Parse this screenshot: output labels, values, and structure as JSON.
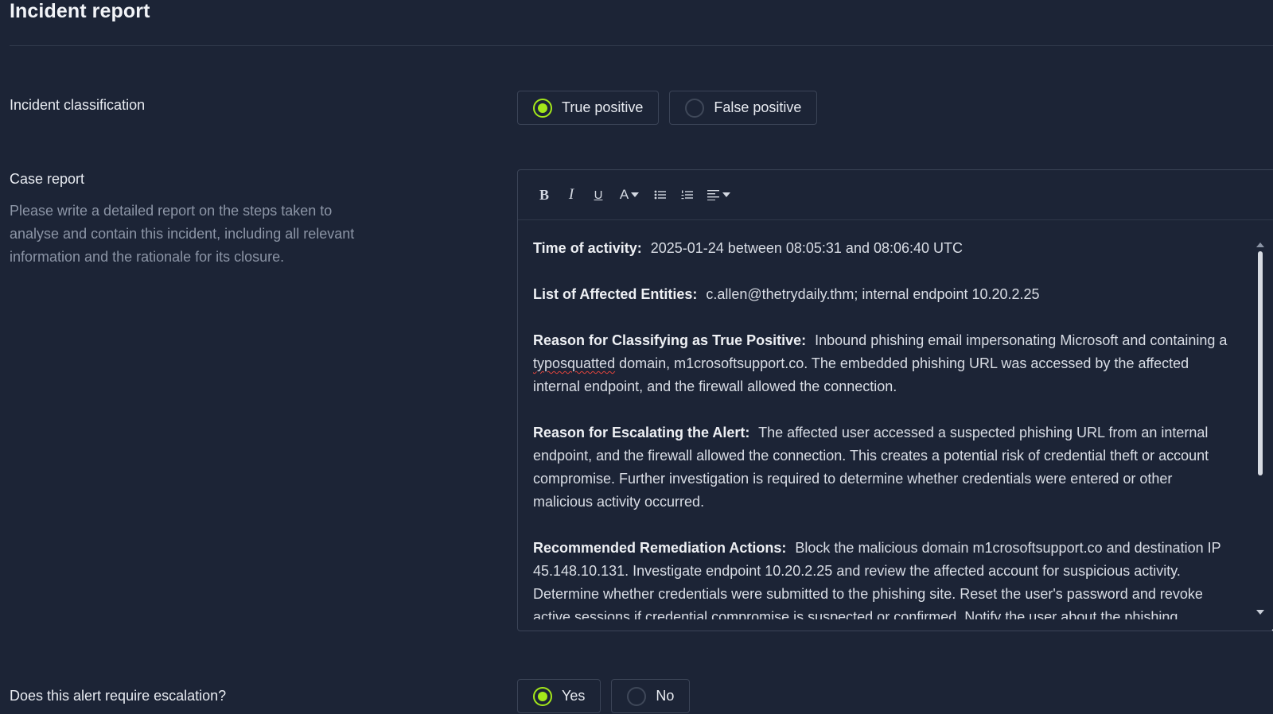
{
  "page": {
    "title": "Incident report"
  },
  "classification": {
    "label": "Incident classification",
    "options": [
      {
        "label": "True positive",
        "selected": true
      },
      {
        "label": "False positive",
        "selected": false
      }
    ]
  },
  "case_report": {
    "label": "Case report",
    "description": "Please write a detailed report on the steps taken to analyse and contain this incident, including all relevant information and the rationale for its closure.",
    "toolbar": {
      "bold": "B",
      "italic": "I",
      "underline": "U",
      "font_color": "A",
      "icons": [
        "bold-icon",
        "italic-icon",
        "underline-icon",
        "font-color-icon",
        "bullet-list-icon",
        "numbered-list-icon",
        "align-icon"
      ]
    },
    "sections": [
      {
        "heading": "Time of activity:",
        "text": "2025-01-24 between 08:05:31 and 08:06:40 UTC"
      },
      {
        "heading": "List of Affected Entities:",
        "text": "c.allen@thetrydaily.thm; internal endpoint 10.20.2.25"
      },
      {
        "heading": "Reason for Classifying as True Positive:",
        "text_before": "Inbound phishing email impersonating Microsoft and containing a",
        "misspelled": "typosquatted",
        "text_after": "domain, m1crosoftsupport.co. The embedded phishing URL was accessed by the affected internal endpoint, and the firewall allowed the connection."
      },
      {
        "heading": "Reason for Escalating the Alert:",
        "text": "The affected user accessed a suspected phishing URL from an internal endpoint, and the firewall allowed the connection. This creates a potential risk of credential theft or account compromise. Further investigation is required to determine whether credentials were entered or other malicious activity occurred."
      },
      {
        "heading": "Recommended Remediation Actions:",
        "text": "Block the malicious domain m1crosoftsupport.co and destination IP 45.148.10.131. Investigate endpoint 10.20.2.25 and review the affected account for suspicious activity. Determine whether credentials were submitted to the phishing site. Reset the user's password and revoke active sessions if credential compromise is suspected or confirmed. Notify the user about the phishing attempt."
      }
    ]
  },
  "escalation": {
    "label": "Does this alert require escalation?",
    "options": [
      {
        "label": "Yes",
        "selected": true
      },
      {
        "label": "No",
        "selected": false
      }
    ]
  },
  "colors": {
    "background": "#1c2436",
    "accent": "#a4e81a",
    "border": "#3b4457",
    "muted_text": "#8c95a6"
  }
}
